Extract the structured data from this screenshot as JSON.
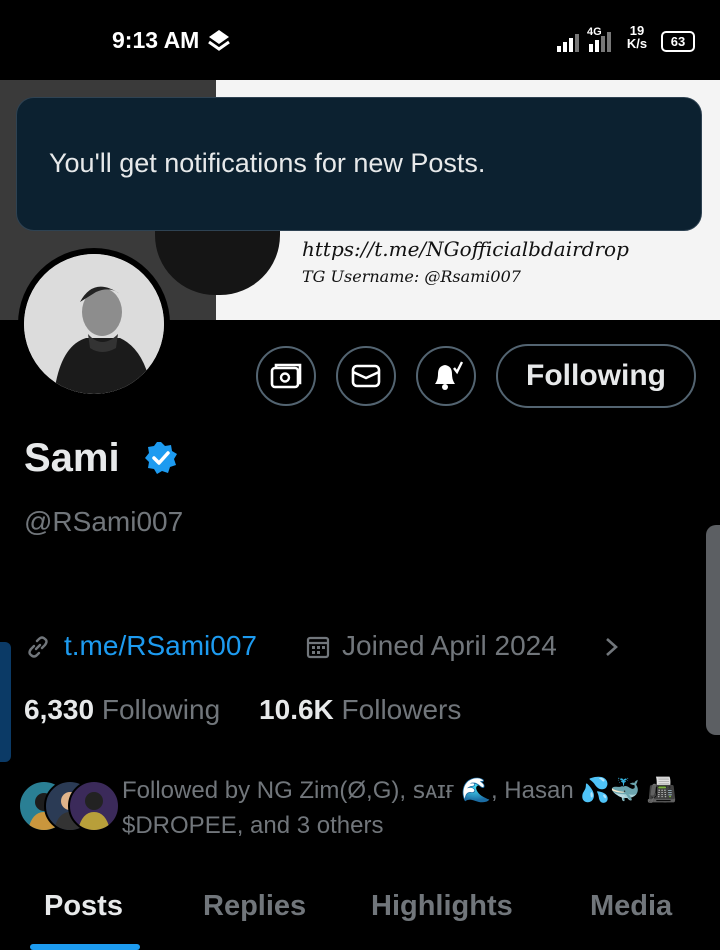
{
  "status_bar": {
    "time": "9:13 AM",
    "network_type": "4G",
    "net_speed_value": "19",
    "net_speed_unit": "K/s",
    "battery": "63",
    "icons": [
      "location-icon",
      "signal-icon",
      "battery-icon"
    ]
  },
  "banner": {
    "url_text": "https://t.me/NGofficialbdairdrop",
    "tg_text": "TG Username: @Rsami007"
  },
  "toast": {
    "message": "You'll get notifications for new Posts."
  },
  "actions": {
    "icons": [
      "subscribe-icon",
      "message-icon",
      "notification-bell-icon"
    ],
    "following_label": "Following"
  },
  "profile": {
    "name": "Sami",
    "handle": "@RSami007",
    "link": "t.me/RSami007",
    "joined": "Joined April 2024",
    "following_count": "6,330",
    "following_label": "Following",
    "followers_count": "10.6K",
    "followers_label": "Followers",
    "followed_by": "Followed by NG Zim(Ø,G), ꜱᴀɪғ 🌊, Hasan 💦🐳 📠 $DROPEE, and 3 others"
  },
  "tabs": [
    {
      "label": "Posts",
      "active": true
    },
    {
      "label": "Replies",
      "active": false
    },
    {
      "label": "Highlights",
      "active": false
    },
    {
      "label": "Media",
      "active": false
    }
  ],
  "colors": {
    "accent": "#1d9bf0",
    "muted_text": "#71767b",
    "toast_bg": "#0c2130",
    "background": "#000000"
  }
}
